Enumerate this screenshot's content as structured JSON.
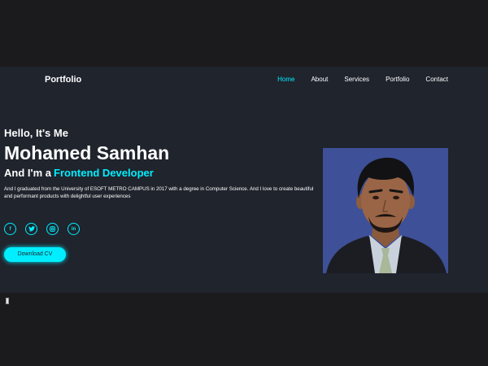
{
  "header": {
    "brand": "Portfolio",
    "nav": [
      "Home",
      "About",
      "Services",
      "Portfolio",
      "Contact"
    ],
    "active_nav": "Home"
  },
  "hero": {
    "greeting": "Hello, It's Me",
    "name": "Mohamed Samhan",
    "role_prefix": "And I'm a",
    "role": "Frontend Developer",
    "bio": "And I graduated from the University of ESOFT METRO CAMPUS in 2017 with a degree in Computer Science. And I love to create beautiful and performant products with delightful user experiences",
    "socials": [
      {
        "icon": "facebook-icon",
        "glyph": "f"
      },
      {
        "icon": "twitter-icon",
        "glyph": "t"
      },
      {
        "icon": "instagram-icon",
        "glyph": "◎"
      },
      {
        "icon": "linkedin-icon",
        "glyph": "in"
      }
    ],
    "cv_button": "Download CV"
  },
  "colors": {
    "background": "#1f242d",
    "accent": "#00eeff",
    "photo_background": "#3e5097"
  }
}
